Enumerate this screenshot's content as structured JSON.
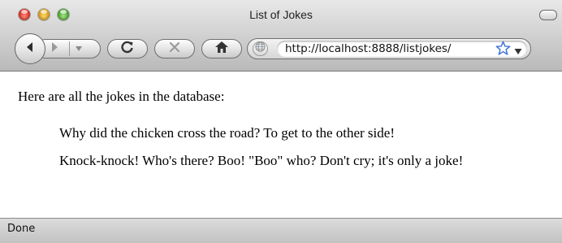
{
  "window": {
    "title": "List of Jokes"
  },
  "toolbar": {
    "back_icon": "back-arrow-icon",
    "forward_icon": "forward-arrow-icon",
    "reload_icon": "reload-icon",
    "stop_icon": "stop-icon",
    "home_icon": "home-icon"
  },
  "address_bar": {
    "url": "http://localhost:8888/listjokes/",
    "site_icon": "globe-icon",
    "bookmark_icon": "star-icon",
    "dropdown_icon": "dropdown-arrow-icon"
  },
  "page": {
    "intro": "Here are all the jokes in the database:",
    "jokes": [
      "Why did the chicken cross the road? To get to the other side!",
      "Knock-knock! Who's there? Boo! \"Boo\" who? Don't cry; it's only a joke!"
    ]
  },
  "status": {
    "text": "Done"
  },
  "colors": {
    "chrome_top": "#e8e8e8",
    "chrome_bottom": "#b9b9b9",
    "close": "#d8261c",
    "minimize": "#d99a12",
    "zoom": "#3e9e24",
    "star": "#3a6fd8"
  }
}
